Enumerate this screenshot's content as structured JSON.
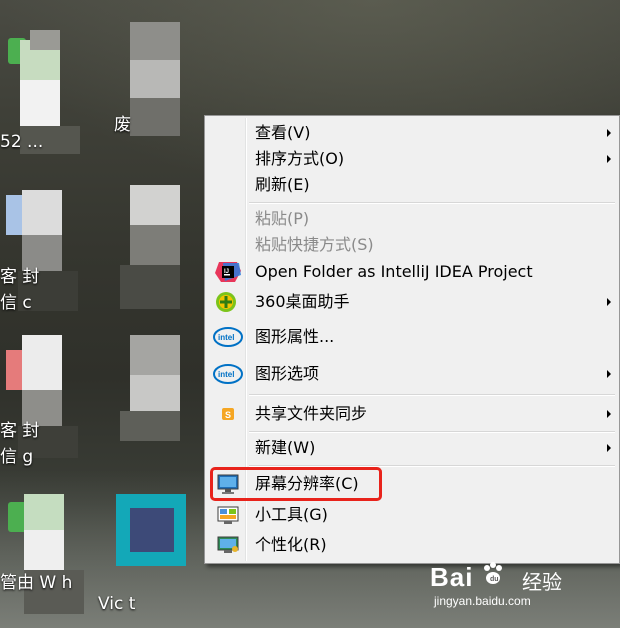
{
  "desktop": {
    "icons": [
      {
        "label": "52 ..."
      },
      {
        "label": "废"
      },
      {
        "label": "客 封",
        "label2": "信 c"
      },
      {
        "label": "客 封",
        "label2": "信 g"
      },
      {
        "label": "管由 W h",
        "label2": "Vic t"
      }
    ]
  },
  "context_menu": {
    "items": [
      {
        "label": "查看(V)",
        "submenu": true
      },
      {
        "label": "排序方式(O)",
        "submenu": true
      },
      {
        "label": "刷新(E)",
        "submenu": false
      },
      {
        "label": "粘贴(P)",
        "disabled": true
      },
      {
        "label": "粘贴快捷方式(S)",
        "disabled": true
      },
      {
        "label": "Open Folder as IntelliJ IDEA Project",
        "icon": "intellij-icon"
      },
      {
        "label": "360桌面助手",
        "icon": "360-plus-icon",
        "submenu": true
      },
      {
        "label": "图形属性...",
        "icon": "intel-icon"
      },
      {
        "label": "图形选项",
        "icon": "intel-icon",
        "submenu": true
      },
      {
        "label": "共享文件夹同步",
        "icon": "share-sync-icon",
        "submenu": true
      },
      {
        "label": "新建(W)",
        "submenu": true
      },
      {
        "label": "屏幕分辨率(C)",
        "icon": "monitor-icon",
        "highlighted": true
      },
      {
        "label": "小工具(G)",
        "icon": "gadgets-icon"
      },
      {
        "label": "个性化(R)",
        "icon": "personalize-icon"
      }
    ]
  },
  "watermark": {
    "brand": "Bai",
    "brand_cn": "经验",
    "url": "jingyan.baidu.com"
  },
  "colors": {
    "highlight": "#e8231b",
    "menu_bg": "#f0f0f0"
  }
}
